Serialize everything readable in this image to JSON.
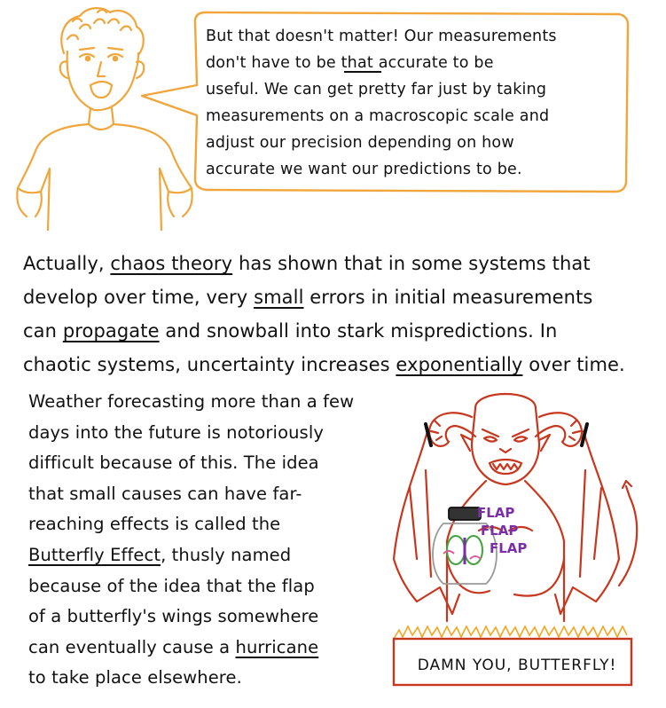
{
  "speech_bubble": {
    "lines": [
      "But that doesn't matter! Our measurements",
      "don't have to be that accurate to be",
      "useful. We can get pretty far just by taking",
      "measurements on a macroscopic scale and",
      "adjust our precision depending on how",
      "accurate we want our predictions to be."
    ],
    "underlined_word": "that"
  },
  "paragraph": {
    "l1_a": "Actually, ",
    "l1_u": "chaos theory",
    "l1_b": " has shown that in some systems that",
    "l2_a": "develop over time, very ",
    "l2_u": "small",
    "l2_b": " errors in initial measurements",
    "l3_a": "can ",
    "l3_u": "propagate",
    "l3_b": " and snowball into stark mispredictions. In",
    "l4_a": "chaotic systems, uncertainty increases ",
    "l4_u": "exponentially",
    "l4_b": " over time."
  },
  "column": {
    "c1": "Weather forecasting more than a few",
    "c2": "days into the future is notoriously",
    "c3": "difficult because of this. The idea",
    "c4": "that small causes can have far-",
    "c5": "reaching effects is called the",
    "c6_u": "Butterfly Effect",
    "c6_b": ", thusly named",
    "c7": "because of the idea that the flap",
    "c8": "of a butterfly's wings somewhere",
    "c9_a": "can eventually cause a ",
    "c9_u": "hurricane",
    "c10": "to take place elsewhere."
  },
  "demon_panel": {
    "flap_words": [
      "FLAP",
      "FLAP",
      "FLAP"
    ],
    "caption": "DAMN YOU, BUTTERFLY!"
  },
  "colors": {
    "orange": "#f0a63a",
    "red": "#c8371d",
    "purple": "#7a2fa8",
    "green": "#3fa33a",
    "fire": "#f5a623"
  }
}
